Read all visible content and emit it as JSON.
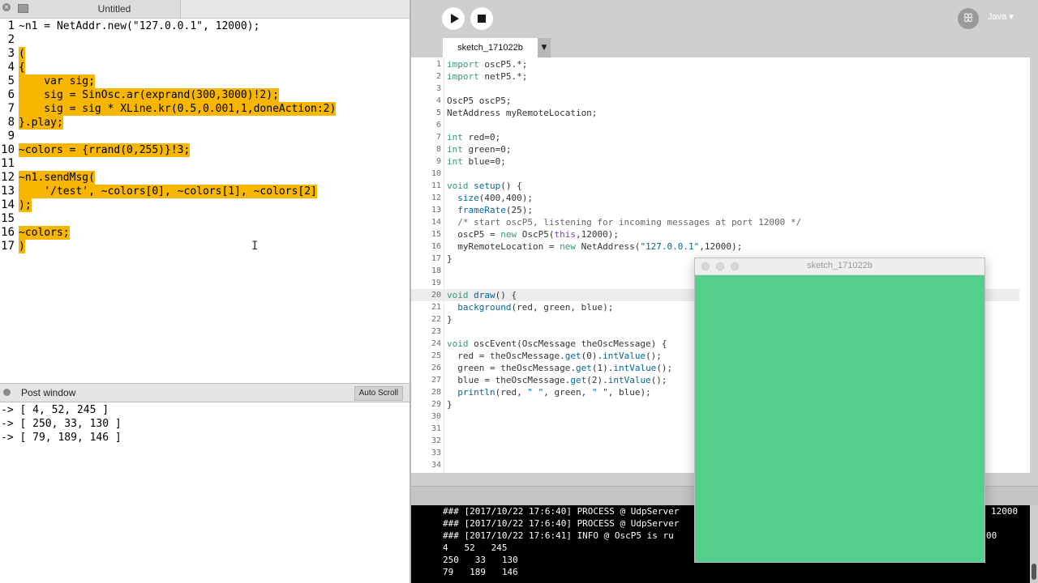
{
  "supercollider": {
    "tab_title": "Untitled",
    "code_lines": [
      {
        "num": "1",
        "code": "~n1 = NetAddr.new(\"127.0.0.1\", 12000);",
        "hl": false
      },
      {
        "num": "2",
        "code": "",
        "hl": false
      },
      {
        "num": "3",
        "code": "(",
        "hl": true
      },
      {
        "num": "4",
        "code": "{",
        "hl": true
      },
      {
        "num": "5",
        "code": "    var sig;",
        "hl": true
      },
      {
        "num": "6",
        "code": "    sig = SinOsc.ar(exprand(300,3000)!2);",
        "hl": true
      },
      {
        "num": "7",
        "code": "    sig = sig * XLine.kr(0.5,0.001,1,doneAction:2)",
        "hl": true
      },
      {
        "num": "8",
        "code": "}.play;",
        "hl": true
      },
      {
        "num": "9",
        "code": "",
        "hl": false
      },
      {
        "num": "10",
        "code": "~colors = {rrand(0,255)}!3;",
        "hl": true
      },
      {
        "num": "11",
        "code": "",
        "hl": false
      },
      {
        "num": "12",
        "code": "~n1.sendMsg(",
        "hl": true
      },
      {
        "num": "13",
        "code": "    '/test', ~colors[0], ~colors[1], ~colors[2]",
        "hl": true
      },
      {
        "num": "14",
        "code": ");",
        "hl": true
      },
      {
        "num": "15",
        "code": "",
        "hl": false
      },
      {
        "num": "16",
        "code": "~colors;",
        "hl": true
      },
      {
        "num": "17",
        "code": ")",
        "hl": true
      }
    ],
    "post_window_label": "Post window",
    "auto_scroll_label": "Auto Scroll",
    "post_lines": [
      "-> [ 4, 52, 245 ]",
      "-> [ 250, 33, 130 ]",
      "-> [ 79, 189, 146 ]"
    ],
    "highlight_color": "#f7b700"
  },
  "processing": {
    "mode": "Java ▾",
    "debug_icon": "butterfly-icon",
    "sketch_tab": "sketch_171022b",
    "tab_menu_glyph": "▼",
    "current_line": "20",
    "code_lines": [
      {
        "num": "1",
        "code": "import oscP5.*;"
      },
      {
        "num": "2",
        "code": "import netP5.*;"
      },
      {
        "num": "3",
        "code": ""
      },
      {
        "num": "4",
        "code": "OscP5 oscP5;"
      },
      {
        "num": "5",
        "code": "NetAddress myRemoteLocation;"
      },
      {
        "num": "6",
        "code": ""
      },
      {
        "num": "7",
        "code": "int red=0;"
      },
      {
        "num": "8",
        "code": "int green=0;"
      },
      {
        "num": "9",
        "code": "int blue=0;"
      },
      {
        "num": "10",
        "code": ""
      },
      {
        "num": "11",
        "code": "void setup() {"
      },
      {
        "num": "12",
        "code": "  size(400,400);"
      },
      {
        "num": "13",
        "code": "  frameRate(25);"
      },
      {
        "num": "14",
        "code": "  /* start oscP5, listening for incoming messages at port 12000 */"
      },
      {
        "num": "15",
        "code": "  oscP5 = new OscP5(this,12000);"
      },
      {
        "num": "16",
        "code": "  myRemoteLocation = new NetAddress(\"127.0.0.1\",12000);"
      },
      {
        "num": "17",
        "code": "}"
      },
      {
        "num": "18",
        "code": ""
      },
      {
        "num": "19",
        "code": ""
      },
      {
        "num": "20",
        "code": "void draw() {"
      },
      {
        "num": "21",
        "code": "  background(red, green, blue);"
      },
      {
        "num": "22",
        "code": "}"
      },
      {
        "num": "23",
        "code": ""
      },
      {
        "num": "24",
        "code": "void oscEvent(OscMessage theOscMessage) {"
      },
      {
        "num": "25",
        "code": "  red = theOscMessage.get(0).intValue();"
      },
      {
        "num": "26",
        "code": "  green = theOscMessage.get(1).intValue();"
      },
      {
        "num": "27",
        "code": "  blue = theOscMessage.get(2).intValue();"
      },
      {
        "num": "28",
        "code": "  println(red, \" \", green, \" \", blue);"
      },
      {
        "num": "29",
        "code": "}"
      },
      {
        "num": "30",
        "code": ""
      },
      {
        "num": "31",
        "code": ""
      },
      {
        "num": "32",
        "code": ""
      },
      {
        "num": "33",
        "code": ""
      },
      {
        "num": "34",
        "code": ""
      }
    ],
    "console_lines": [
      "### [2017/10/22 17:6:40] PROCESS @ UdpServer",
      "### [2017/10/22 17:6:40] PROCESS @ UdpServer",
      "### [2017/10/22 17:6:41] INFO @ OscP5 is ru",
      "4   52   245",
      "250   33   130",
      "79   189   146"
    ],
    "console_right_1": "12000",
    "console_right_3": "00"
  },
  "sketch_window": {
    "title": "sketch_171022b",
    "background_color": "#55cf8e",
    "rgb": [
      79,
      189,
      146
    ]
  }
}
